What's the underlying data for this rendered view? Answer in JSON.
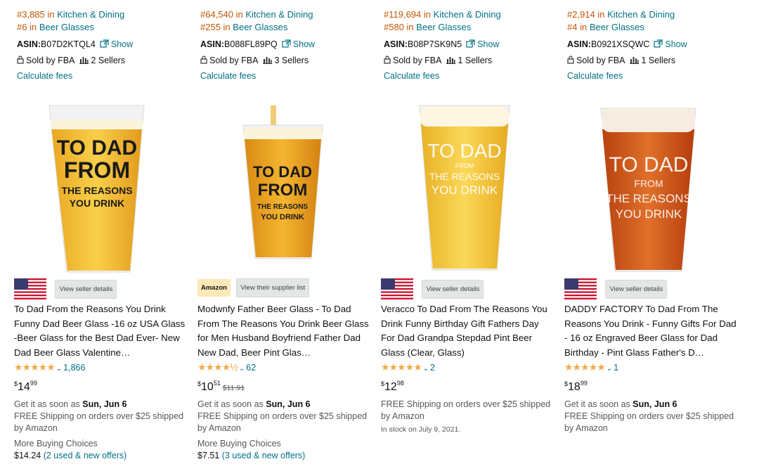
{
  "products": [
    {
      "rank1_pos": "#3,885",
      "rank1_in": "in",
      "rank1_cat": "Kitchen & Dining",
      "rank2_pos": "#6",
      "rank2_in": "in",
      "rank2_cat": "Beer Glasses",
      "asin_label": "ASIN:",
      "asin": "B07D2KTQL4",
      "show": "Show",
      "sold_by": "Sold by FBA",
      "sellers": "2 Sellers",
      "fees": "Calculate fees",
      "glass_text": [
        "TO DAD",
        "FROM",
        "THE REASONS",
        "YOU DRINK"
      ],
      "badge_type": "flag",
      "badge_text": "",
      "details_btn": "View seller details",
      "title": "To Dad From the Reasons You Drink Funny Dad Beer Glass -16 oz USA Glass -Beer Glass for the Best Dad Ever- New Dad Beer Glass Valentine…",
      "stars": "★★★★★",
      "rating_count": "1,866",
      "price_cur": "$",
      "price_whole": "14",
      "price_frac": "99",
      "price_old": "",
      "delivery_prefix": "Get it as soon as",
      "delivery_date": "Sun, Jun 6",
      "shipping": "FREE Shipping on orders over $25 shipped by Amazon",
      "stock": "",
      "mbc_label": "More Buying Choices",
      "mbc_price": "$14.24",
      "mbc_offers": "(2 used & new offers)"
    },
    {
      "rank1_pos": "#64,540",
      "rank1_in": "in",
      "rank1_cat": "Kitchen & Dining",
      "rank2_pos": "#255",
      "rank2_in": "in",
      "rank2_cat": "Beer Glasses",
      "asin_label": "ASIN:",
      "asin": "B088FL89PQ",
      "show": "Show",
      "sold_by": "Sold by FBA",
      "sellers": "3 Sellers",
      "fees": "Calculate fees",
      "glass_text": [
        "TO DAD",
        "FROM",
        "THE REASONS",
        "YOU DRINK"
      ],
      "badge_type": "amazon",
      "badge_text": "Amazon",
      "details_btn": "View their supplier list",
      "title": "Modwnfy Father Beer Glass - To Dad From The Reasons You Drink Beer Glass for Men Husband Boyfriend Father Dad New Dad, Beer Pint Glas…",
      "stars": "★★★★½",
      "rating_count": "62",
      "price_cur": "$",
      "price_whole": "10",
      "price_frac": "51",
      "price_old": "$11.91",
      "delivery_prefix": "Get it as soon as",
      "delivery_date": "Sun, Jun 6",
      "shipping": "FREE Shipping on orders over $25 shipped by Amazon",
      "stock": "",
      "mbc_label": "More Buying Choices",
      "mbc_price": "$7.51",
      "mbc_offers": "(3 used & new offers)"
    },
    {
      "rank1_pos": "#119,694",
      "rank1_in": "in",
      "rank1_cat": "Kitchen & Dining",
      "rank2_pos": "#580",
      "rank2_in": "in",
      "rank2_cat": "Beer Glasses",
      "asin_label": "ASIN:",
      "asin": "B08P7SK9N5",
      "show": "Show",
      "sold_by": "Sold by FBA",
      "sellers": "1 Sellers",
      "fees": "Calculate fees",
      "glass_text": [
        "TO DAD",
        "FROM",
        "THE REASONS",
        "YOU DRINK"
      ],
      "badge_type": "flag",
      "badge_text": "",
      "details_btn": "View seller details",
      "title": "Veracco To Dad From The Reasons You Drink Funny Birthday Gift Fathers Day For Dad Grandpa Stepdad Pint Beer Glass (Clear, Glass)",
      "stars": "★★★★★",
      "rating_count": "2",
      "price_cur": "$",
      "price_whole": "12",
      "price_frac": "98",
      "price_old": "",
      "delivery_prefix": "",
      "delivery_date": "",
      "shipping": "FREE Shipping on orders over $25 shipped by Amazon",
      "stock": "In stock on July 9, 2021.",
      "mbc_label": "",
      "mbc_price": "",
      "mbc_offers": ""
    },
    {
      "rank1_pos": "#2,914",
      "rank1_in": "in",
      "rank1_cat": "Kitchen & Dining",
      "rank2_pos": "#4",
      "rank2_in": "in",
      "rank2_cat": "Beer Glasses",
      "asin_label": "ASIN:",
      "asin": "B0921XSQWC",
      "show": "Show",
      "sold_by": "Sold by FBA",
      "sellers": "1 Sellers",
      "fees": "Calculate fees",
      "glass_text": [
        "TO DAD",
        "FROM",
        "THE REASONS",
        "YOU DRINK"
      ],
      "badge_type": "flag",
      "badge_text": "",
      "details_btn": "View seller details",
      "title": "DADDY FACTORY To Dad From The Reasons You Drink - Funny Gifts For Dad - 16 oz Engraved Beer Glass for Dad Birthday - Pint Glass Father's D…",
      "stars": "★★★★★",
      "rating_count": "1",
      "price_cur": "$",
      "price_whole": "18",
      "price_frac": "99",
      "price_old": "",
      "delivery_prefix": "Get it as soon as",
      "delivery_date": "Sun, Jun 6",
      "shipping": "FREE Shipping on orders over $25 shipped by Amazon",
      "stock": "",
      "mbc_label": "",
      "mbc_price": "",
      "mbc_offers": ""
    }
  ],
  "colors": {
    "link": "#007185",
    "rank": "#c45500",
    "star": "#f3a847",
    "beer_light": "#f6c43a",
    "beer_dark": "#d9661e"
  }
}
